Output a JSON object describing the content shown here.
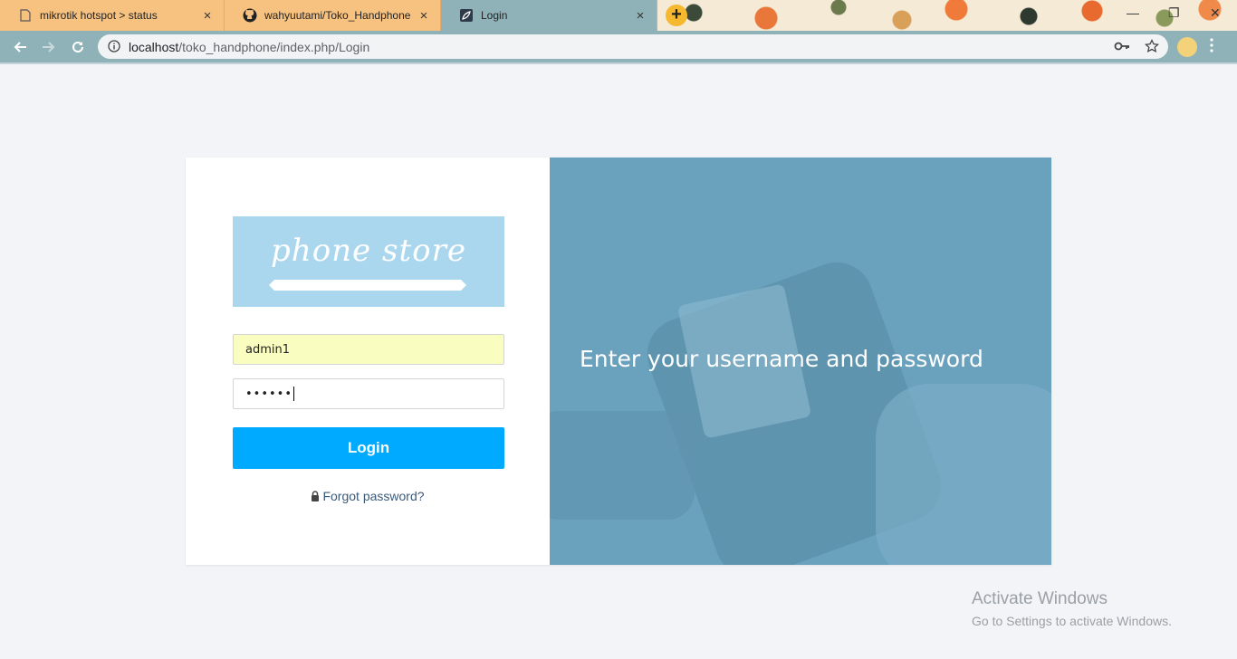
{
  "browser": {
    "tabs": [
      {
        "label": "mikrotik hotspot > status",
        "icon": "page-icon",
        "close": "×"
      },
      {
        "label": "wahyuutami/Toko_Handphone",
        "icon": "github-icon",
        "close": "×"
      },
      {
        "label": "Login",
        "icon": "leaf-icon",
        "close": "×"
      }
    ],
    "new_tab": "+",
    "window_controls": {
      "minimize": "—",
      "restore": "❐",
      "close": "✕"
    },
    "url_host": "localhost",
    "url_path": "/toko_handphone/index.php/Login"
  },
  "login": {
    "logo_text": "phone store",
    "username_value": "admin1",
    "password_mask": "••••••",
    "login_label": "Login",
    "forgot_label": "Forgot password?"
  },
  "hero": {
    "headline": "Enter your username and password"
  },
  "os": {
    "watermark_title": "Activate Windows",
    "watermark_sub": "Go to Settings to activate Windows."
  },
  "colors": {
    "accent": "#00aaff",
    "hero_bg": "#6aa1bd",
    "logo_bg": "#aad7ed",
    "autofill_bg": "#fafdc0"
  }
}
